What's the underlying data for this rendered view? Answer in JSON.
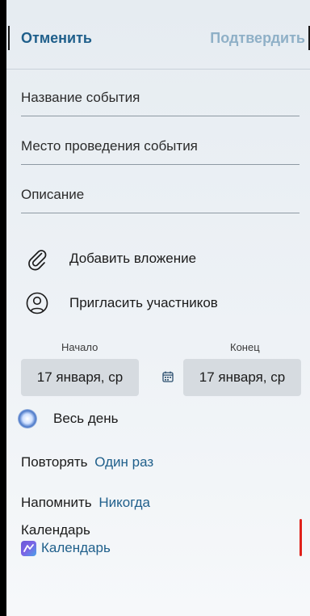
{
  "header": {
    "cancel_label": "Отменить",
    "confirm_label": "Подтвердить"
  },
  "form": {
    "title_label": "Название события",
    "location_label": "Место проведения события",
    "description_label": "Описание"
  },
  "actions": {
    "attach_label": "Добавить вложение",
    "attach_icon": "paperclip-icon",
    "invite_label": "Пригласить участников",
    "invite_icon": "person-icon"
  },
  "dates": {
    "start_label": "Начало",
    "end_label": "Конец",
    "start_value": "17 января, ср",
    "end_value": "17 января, ср",
    "calendar_icon": "calendar-icon"
  },
  "all_day": {
    "label": "Весь день",
    "enabled": false
  },
  "repeat": {
    "label": "Повторять",
    "value": "Один раз"
  },
  "remind": {
    "label": "Напомнить",
    "value": "Никогда"
  },
  "calendar": {
    "label": "Календарь",
    "value": "Календарь",
    "icon": "calendar-color-icon"
  },
  "colors": {
    "accent": "#1f5f8b",
    "accent_disabled": "#8fb0c7",
    "date_button_bg": "#d6dbe0",
    "marker": "#e0211b"
  }
}
